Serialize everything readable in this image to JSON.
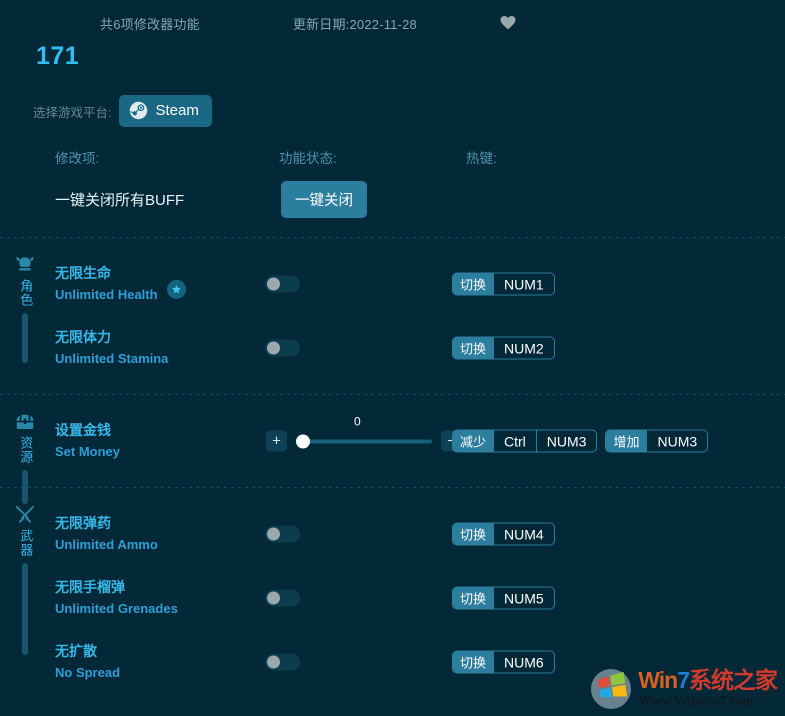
{
  "header": {
    "feature_count_text": "共6项修改器功能",
    "update_date_text": "更新日期:2022-11-28",
    "favorite_icon": "heart-icon",
    "trainer_number": "171"
  },
  "platform": {
    "label": "选择游戏平台:",
    "selected": "Steam",
    "icon": "steam-icon"
  },
  "columns": {
    "item": "修改项:",
    "status": "功能状态:",
    "hotkey": "热键:"
  },
  "all_off": {
    "label": "一键关闭所有BUFF",
    "button": "一键关闭"
  },
  "colors": {
    "background": "#032838",
    "accent": "#2b7e9e",
    "accent_text": "#37b7e8",
    "muted_text": "#5f8a99",
    "toggle_off_track": "#0a3d4e",
    "toggle_knob": "#9aa7ab"
  },
  "sections": [
    {
      "name_cn": "角色",
      "icon": "character-helmet-icon",
      "rows": [
        {
          "name_cn": "无限生命",
          "name_en": "Unlimited Health",
          "badge": "star-icon",
          "control": "toggle",
          "toggle_state": "off",
          "hotkeys": [
            {
              "action": "切换",
              "keys": [
                "NUM1"
              ]
            }
          ]
        },
        {
          "name_cn": "无限体力",
          "name_en": "Unlimited Stamina",
          "control": "toggle",
          "toggle_state": "off",
          "hotkeys": [
            {
              "action": "切换",
              "keys": [
                "NUM2"
              ]
            }
          ]
        }
      ]
    },
    {
      "name_cn": "资源",
      "icon": "treasure-chest-icon",
      "rows": [
        {
          "name_cn": "设置金钱",
          "name_en": "Set Money",
          "control": "slider",
          "slider_value": "0",
          "slider_percent": 0,
          "increase_glyph": "+",
          "decrease_glyph": "−",
          "hotkeys": [
            {
              "action": "减少",
              "keys": [
                "Ctrl",
                "NUM3"
              ]
            },
            {
              "action": "增加",
              "keys": [
                "NUM3"
              ]
            }
          ]
        }
      ]
    },
    {
      "name_cn": "武器",
      "icon": "crossed-swords-icon",
      "rows": [
        {
          "name_cn": "无限弹药",
          "name_en": "Unlimited Ammo",
          "control": "toggle",
          "toggle_state": "off",
          "hotkeys": [
            {
              "action": "切换",
              "keys": [
                "NUM4"
              ]
            }
          ]
        },
        {
          "name_cn": "无限手榴弹",
          "name_en": "Unlimited Grenades",
          "control": "toggle",
          "toggle_state": "off",
          "hotkeys": [
            {
              "action": "切换",
              "keys": [
                "NUM5"
              ]
            }
          ]
        },
        {
          "name_cn": "无扩散",
          "name_en": "No Spread",
          "control": "toggle",
          "toggle_state": "off",
          "hotkeys": [
            {
              "action": "切换",
              "keys": [
                "NUM6"
              ]
            }
          ]
        }
      ]
    }
  ],
  "watermark": {
    "title_win": "Win",
    "title_seven": "7",
    "title_cn": "系统之家",
    "url": "Www.Winwin7.com"
  }
}
